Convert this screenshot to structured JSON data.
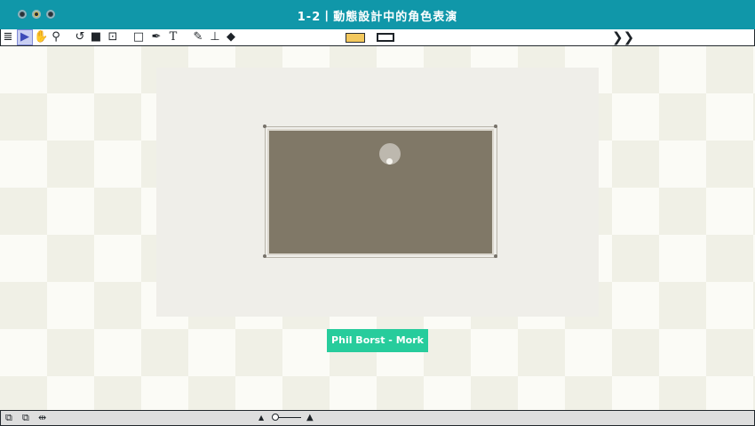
{
  "window": {
    "title": "1-2丨動態設計中的角色表演"
  },
  "toolbar": {
    "tools": [
      {
        "name": "menu-icon",
        "glyph": "≣"
      },
      {
        "name": "select-arrow-icon",
        "glyph": "▶"
      },
      {
        "name": "hand-icon",
        "glyph": "✋"
      },
      {
        "name": "zoom-icon",
        "glyph": "⚲"
      },
      {
        "name": "rotate-icon",
        "glyph": "↺"
      },
      {
        "name": "camera-icon",
        "glyph": "■"
      },
      {
        "name": "anchor-point-icon",
        "glyph": "⊡"
      },
      {
        "name": "rectangle-icon",
        "glyph": "□"
      },
      {
        "name": "pen-icon",
        "glyph": "✒"
      },
      {
        "name": "text-icon",
        "glyph": "T"
      },
      {
        "name": "brush-icon",
        "glyph": "✎"
      },
      {
        "name": "stamp-icon",
        "glyph": "⊥"
      },
      {
        "name": "eraser-icon",
        "glyph": "◆"
      }
    ],
    "expand_glyph": "❯❯",
    "fill_color": "#f3c85d",
    "stroke_color": "#1e2328"
  },
  "canvas": {
    "caption": "Phil Borst - Mork",
    "frame_color": "#807867",
    "caption_color": "#27cc9c"
  },
  "statusbar": {
    "left_icons": [
      {
        "name": "layers-icon",
        "glyph": "⧉"
      },
      {
        "name": "composition-icon",
        "glyph": "⧉"
      },
      {
        "name": "align-icon",
        "glyph": "⇹"
      }
    ],
    "zoom_out_glyph": "▲",
    "zoom_in_glyph": "▲",
    "zoom_level": 0
  }
}
